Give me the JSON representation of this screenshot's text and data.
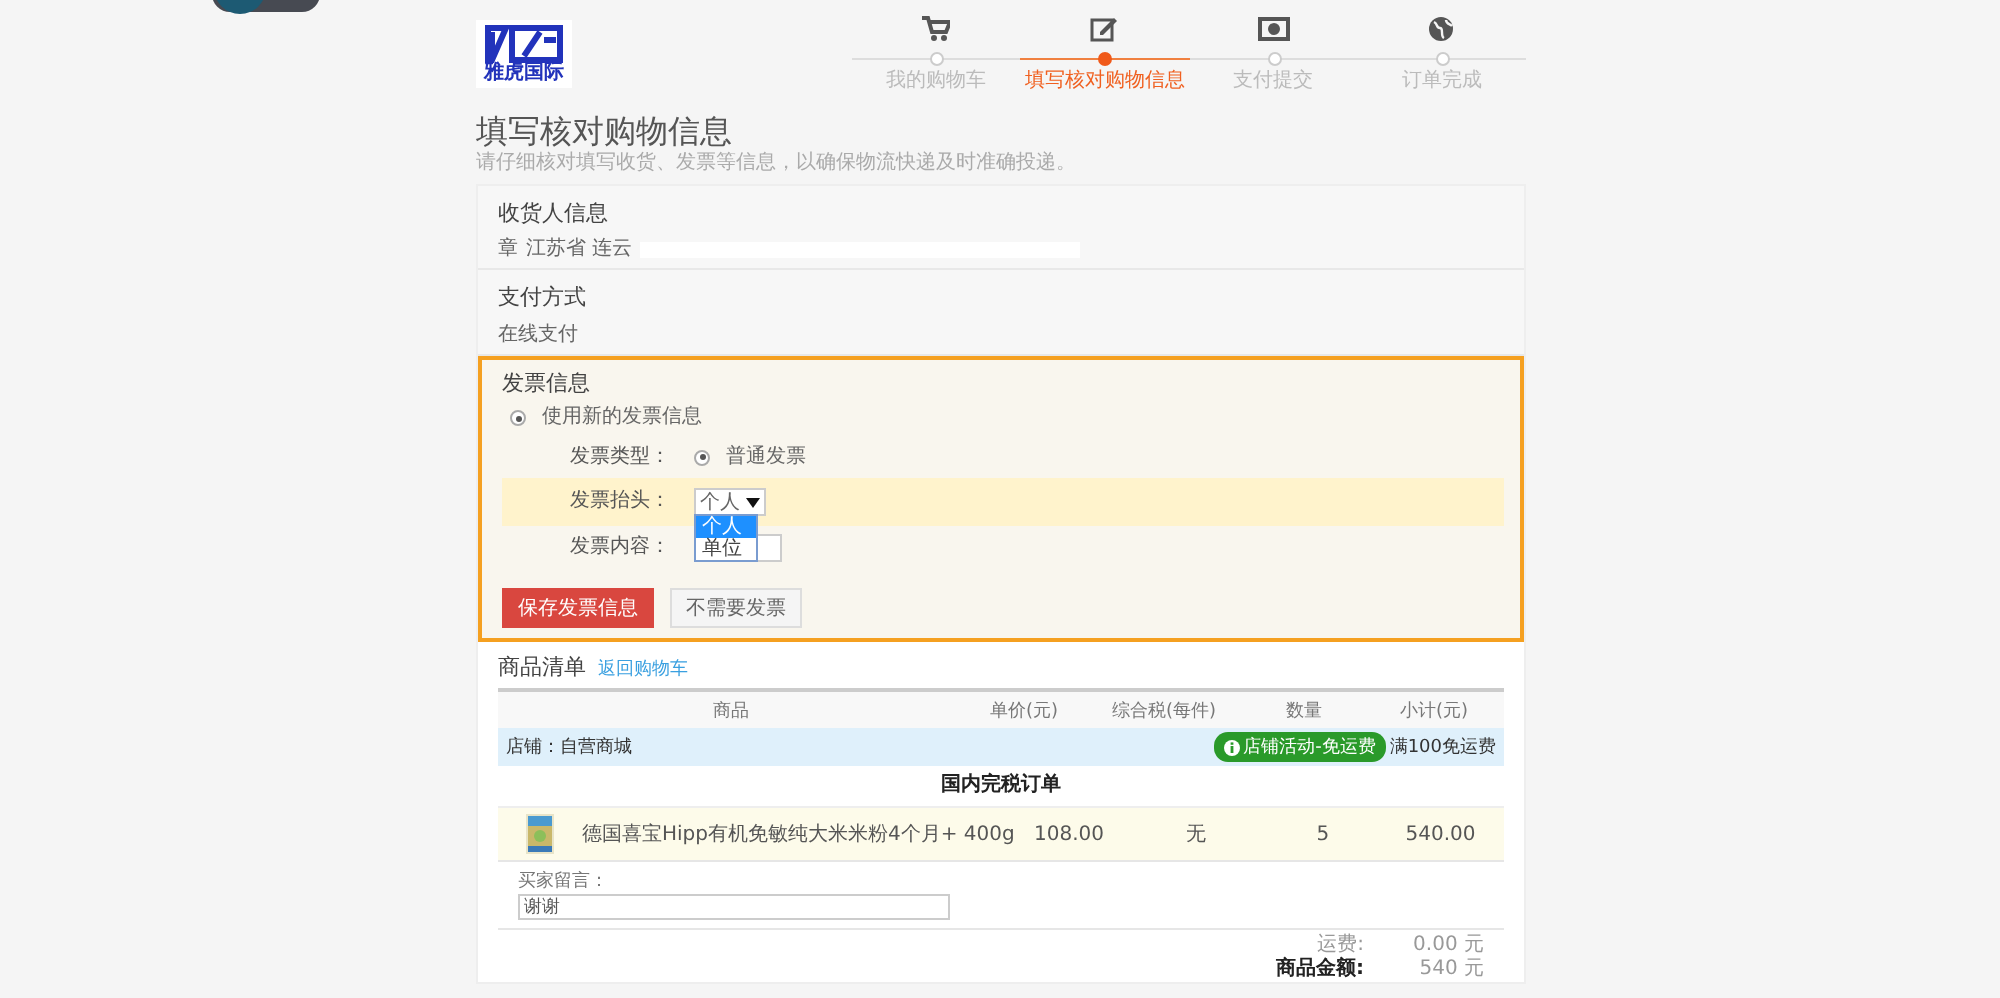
{
  "header": {
    "logo_text": "雅虎国际",
    "steps": [
      {
        "label": "我的购物车",
        "selected": false
      },
      {
        "label": "填写核对购物信息",
        "selected": true
      },
      {
        "label": "支付提交",
        "selected": false
      },
      {
        "label": "订单完成",
        "selected": false
      }
    ]
  },
  "page_title": "填写核对购物信息",
  "page_subtitle": "请仔细核对填写收货、发票等信息，以确保物流快递及时准确投递。",
  "receiver": {
    "title": "收货人信息",
    "name": "章",
    "address": "江苏省 连云"
  },
  "payment": {
    "title": "支付方式",
    "method": "在线支付"
  },
  "invoice": {
    "title": "发票信息",
    "use_new": {
      "label": "使用新的发票信息",
      "checked": true
    },
    "type": {
      "label": "发票类型：",
      "option": "普通发票",
      "checked": true
    },
    "header_field": {
      "label": "发票抬头：",
      "value": "个人",
      "expanded": true,
      "options": [
        {
          "label": "个人",
          "selected": true
        },
        {
          "label": "单位",
          "selected": false
        }
      ]
    },
    "content_field": {
      "label": "发票内容："
    },
    "buttons": [
      {
        "label": "保存发票信息",
        "kind": "primary"
      },
      {
        "label": "不需要发票",
        "kind": "secondary"
      }
    ]
  },
  "goods": {
    "title": "商品清单",
    "link": "返回购物车",
    "columns": [
      "商品",
      "单价(元)",
      "综合税(每件)",
      "数量",
      "小计(元)"
    ],
    "store": {
      "label": "店铺：自营商城",
      "badge": "店铺活动-免运费",
      "promo": "满100免运费"
    },
    "order_type": "国内完税订单",
    "items": [
      {
        "name": "德国喜宝Hipp有机免敏纯大米米粉4个月+ 400g",
        "price": "108.00",
        "tax": "无",
        "qty": "5",
        "subtotal": "540.00"
      }
    ],
    "message": {
      "label": "买家留言：",
      "value": "谢谢"
    },
    "totals": [
      {
        "label": "运费:",
        "value": "0.00 元",
        "bold": false
      },
      {
        "label": "商品金额:",
        "value": "540 元",
        "bold": true
      }
    ]
  }
}
